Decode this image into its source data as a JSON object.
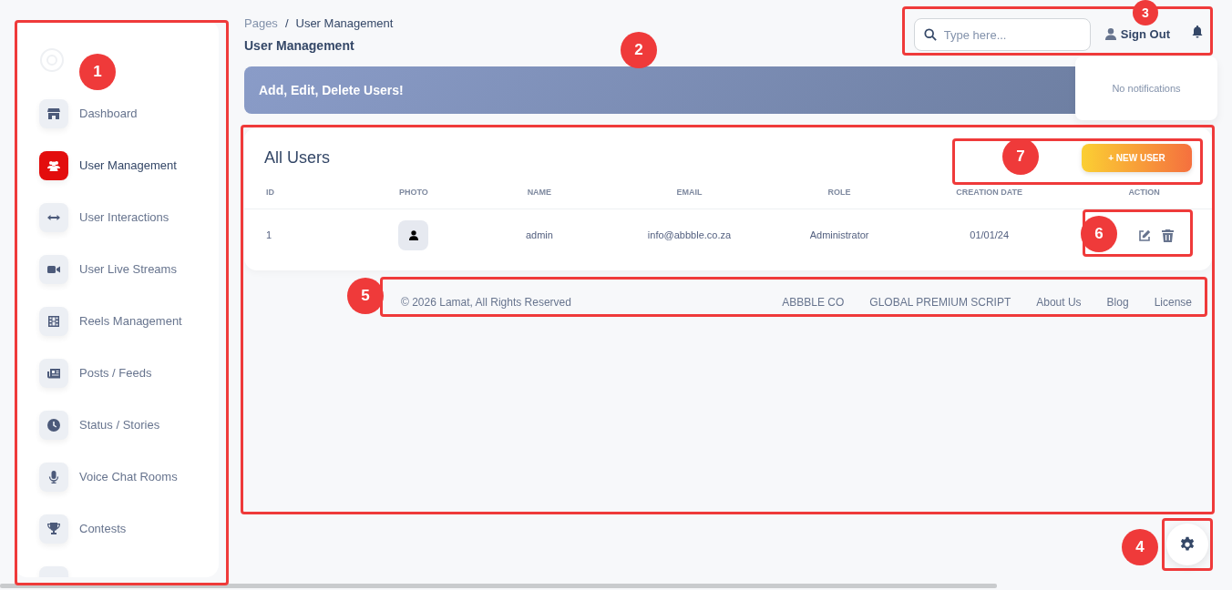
{
  "sidebar": {
    "items": [
      {
        "label": "Dashboard",
        "selected": false
      },
      {
        "label": "User Management",
        "selected": true
      },
      {
        "label": "User Interactions",
        "selected": false
      },
      {
        "label": "User Live Streams",
        "selected": false
      },
      {
        "label": "Reels Management",
        "selected": false
      },
      {
        "label": "Posts / Feeds",
        "selected": false
      },
      {
        "label": "Status / Stories",
        "selected": false
      },
      {
        "label": "Voice Chat Rooms",
        "selected": false
      },
      {
        "label": "Contests",
        "selected": false
      }
    ]
  },
  "breadcrumb": {
    "items": [
      "Pages",
      "User Management"
    ],
    "separator": "/"
  },
  "page_title": "User Management",
  "search": {
    "placeholder": "Type here..."
  },
  "sign_out": "Sign Out",
  "notifications": {
    "empty_text": "No notifications"
  },
  "banner": "Add, Edit, Delete Users!",
  "users_card": {
    "title": "All Users",
    "new_button": "+ NEW USER",
    "table": {
      "columns": [
        "ID",
        "PHOTO",
        "NAME",
        "EMAIL",
        "ROLE",
        "CREATION DATE",
        "ACTION"
      ],
      "rows": [
        {
          "id": "1",
          "name": "admin",
          "email": "info@abbble.co.za",
          "role": "Administrator",
          "created": "01/01/24"
        }
      ]
    }
  },
  "footer": {
    "copyright": "© 2026 Lamat, All Rights Reserved",
    "links": [
      "ABBBLE CO",
      "GLOBAL PREMIUM SCRIPT",
      "About Us",
      "Blog",
      "License"
    ]
  },
  "annotations": [
    {
      "label": "1"
    },
    {
      "label": "2"
    },
    {
      "label": "3"
    },
    {
      "label": "4"
    },
    {
      "label": "5"
    },
    {
      "label": "6"
    },
    {
      "label": "7"
    }
  ]
}
